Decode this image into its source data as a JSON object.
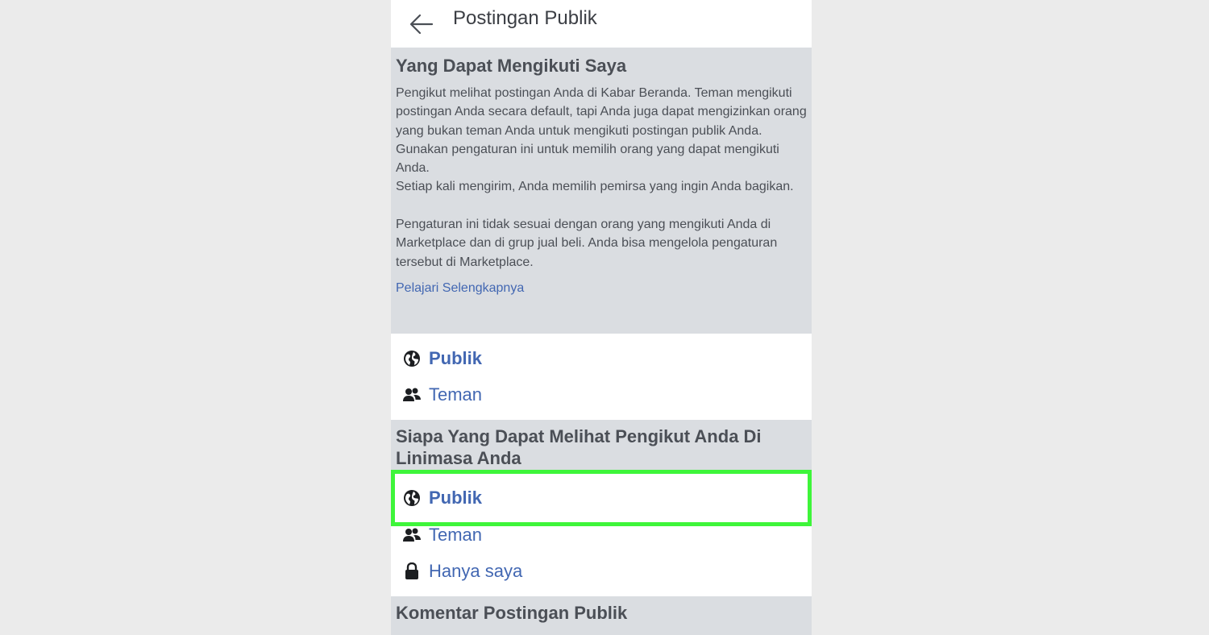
{
  "header": {
    "title": "Postingan Publik",
    "back_icon": "arrow-left-icon"
  },
  "section1": {
    "heading": "Yang Dapat Mengikuti Saya",
    "description": "Pengikut melihat postingan Anda di Kabar Beranda. Teman mengikuti postingan Anda secara default, tapi Anda juga dapat mengizinkan orang yang bukan teman Anda untuk mengikuti postingan publik Anda. Gunakan pengaturan ini untuk memilih orang yang dapat mengikuti Anda.\nSetiap kali mengirim, Anda memilih pemirsa yang ingin Anda bagikan.\n\nPengaturan ini tidak sesuai dengan orang yang mengikuti Anda di Marketplace dan di grup jual beli. Anda bisa mengelola pengaturan tersebut di Marketplace.",
    "learn_more": "Pelajari Selengkapnya",
    "options": [
      {
        "label": "Publik",
        "icon": "globe-icon",
        "selected": true
      },
      {
        "label": "Teman",
        "icon": "friends-icon",
        "selected": false
      }
    ]
  },
  "section2": {
    "heading": "Siapa Yang Dapat Melihat Pengikut Anda Di Linimasa Anda",
    "options": [
      {
        "label": "Publik",
        "icon": "globe-icon",
        "selected": true,
        "highlighted": true
      },
      {
        "label": "Teman",
        "icon": "friends-icon",
        "selected": false
      },
      {
        "label": "Hanya saya",
        "icon": "lock-icon",
        "selected": false
      }
    ]
  },
  "section3": {
    "heading": "Komentar Postingan Publik"
  },
  "colors": {
    "link": "#4267b2",
    "section_bg": "#dadde1",
    "highlight": "#3ef53a"
  }
}
